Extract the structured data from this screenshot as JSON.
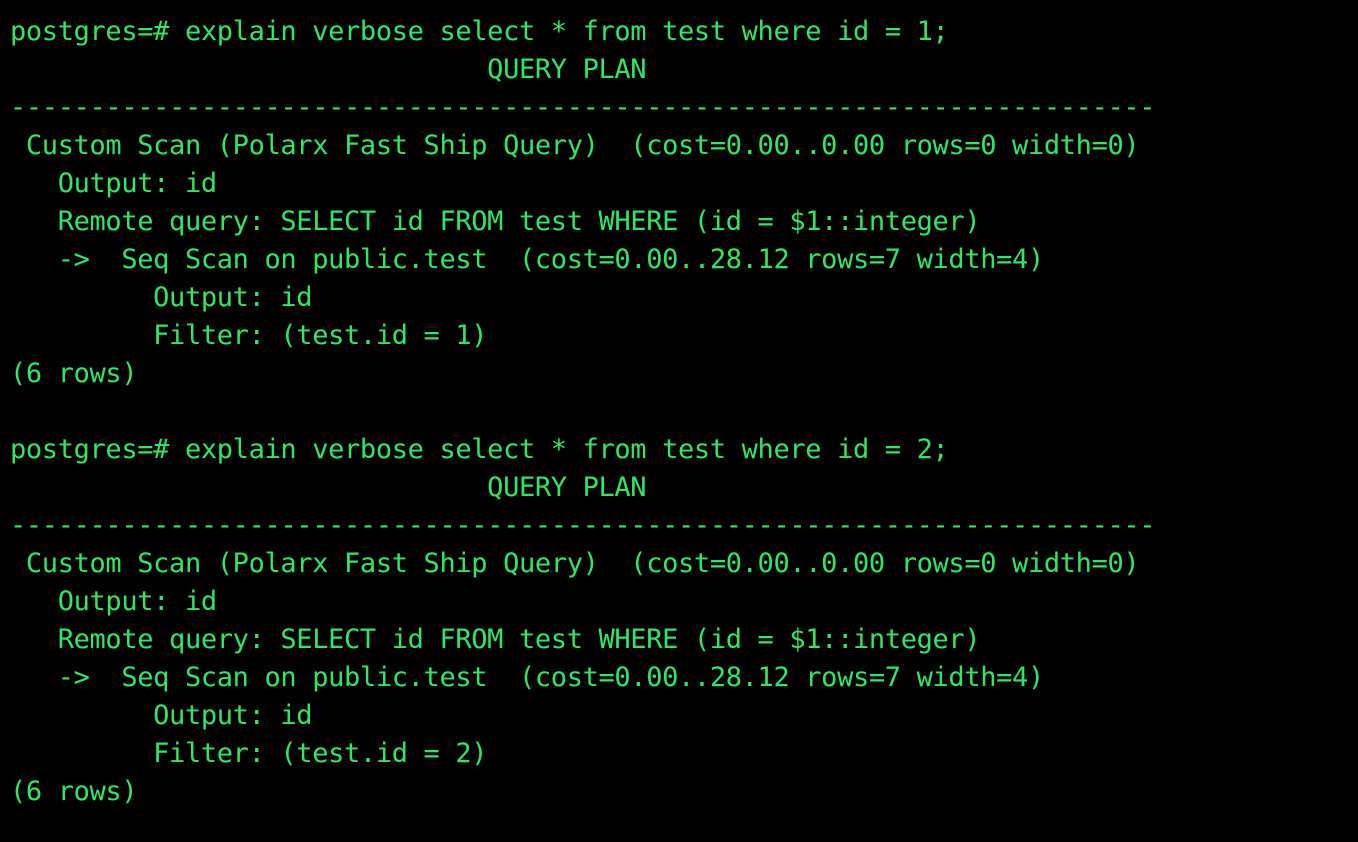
{
  "terminal": {
    "colors": {
      "background": "#000000",
      "text": "#32e664"
    },
    "lines": [
      "postgres=# explain verbose select * from test where id = 1;",
      "                              QUERY PLAN",
      "------------------------------------------------------------------------",
      " Custom Scan (Polarx Fast Ship Query)  (cost=0.00..0.00 rows=0 width=0)",
      "   Output: id",
      "   Remote query: SELECT id FROM test WHERE (id = $1::integer)",
      "   ->  Seq Scan on public.test  (cost=0.00..28.12 rows=7 width=4)",
      "         Output: id",
      "         Filter: (test.id = 1)",
      "(6 rows)",
      "",
      "postgres=# explain verbose select * from test where id = 2;",
      "                              QUERY PLAN",
      "------------------------------------------------------------------------",
      " Custom Scan (Polarx Fast Ship Query)  (cost=0.00..0.00 rows=0 width=0)",
      "   Output: id",
      "   Remote query: SELECT id FROM test WHERE (id = $1::integer)",
      "   ->  Seq Scan on public.test  (cost=0.00..28.12 rows=7 width=4)",
      "         Output: id",
      "         Filter: (test.id = 2)",
      "(6 rows)"
    ]
  }
}
